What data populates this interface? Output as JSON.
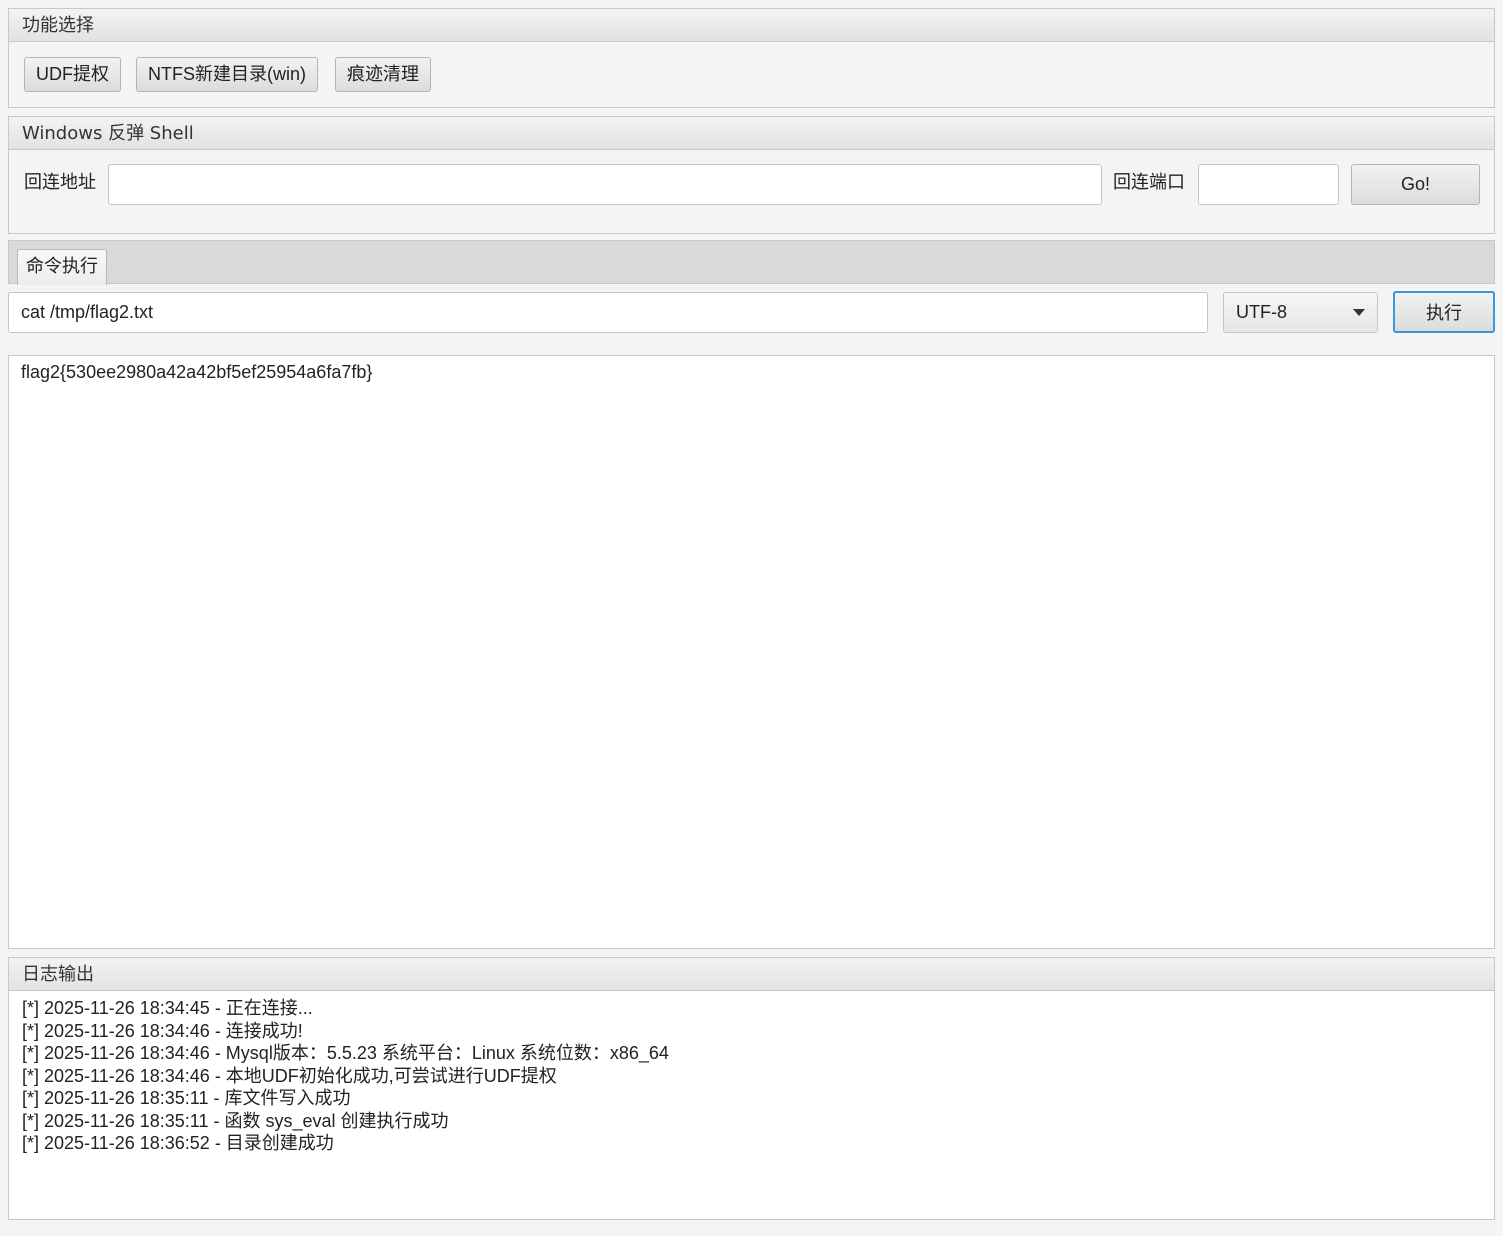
{
  "func_panel": {
    "title": "功能选择",
    "buttons": [
      "UDF提权",
      "NTFS新建目录(win)",
      "痕迹清理"
    ]
  },
  "shell_panel": {
    "title": "Windows 反弹 Shell",
    "host_label": "回连地址",
    "host_value": "",
    "port_label": "回连端口",
    "port_value": "",
    "go_label": "Go!"
  },
  "cmd": {
    "tab_label": "命令执行",
    "command_value": "cat /tmp/flag2.txt",
    "encoding": "UTF-8",
    "exec_label": "执行",
    "output": "flag2{530ee2980a42a42bf5ef25954a6fa7fb}"
  },
  "log": {
    "title": "日志输出",
    "lines": [
      "[*] 2025-11-26 18:34:45 - 正在连接...",
      "[*] 2025-11-26 18:34:46 - 连接成功!",
      "[*] 2025-11-26 18:34:46 - Mysql版本：5.5.23 系统平台：Linux 系统位数：x86_64",
      "[*] 2025-11-26 18:34:46 - 本地UDF初始化成功,可尝试进行UDF提权",
      "[*] 2025-11-26 18:35:11 - 库文件写入成功",
      "[*] 2025-11-26 18:35:11 - 函数 sys_eval 创建执行成功",
      "[*] 2025-11-26 18:36:52 - 目录创建成功"
    ]
  },
  "colors": {
    "focus_border": "#3a9ad9",
    "panel_bg": "#f4f4f4"
  }
}
